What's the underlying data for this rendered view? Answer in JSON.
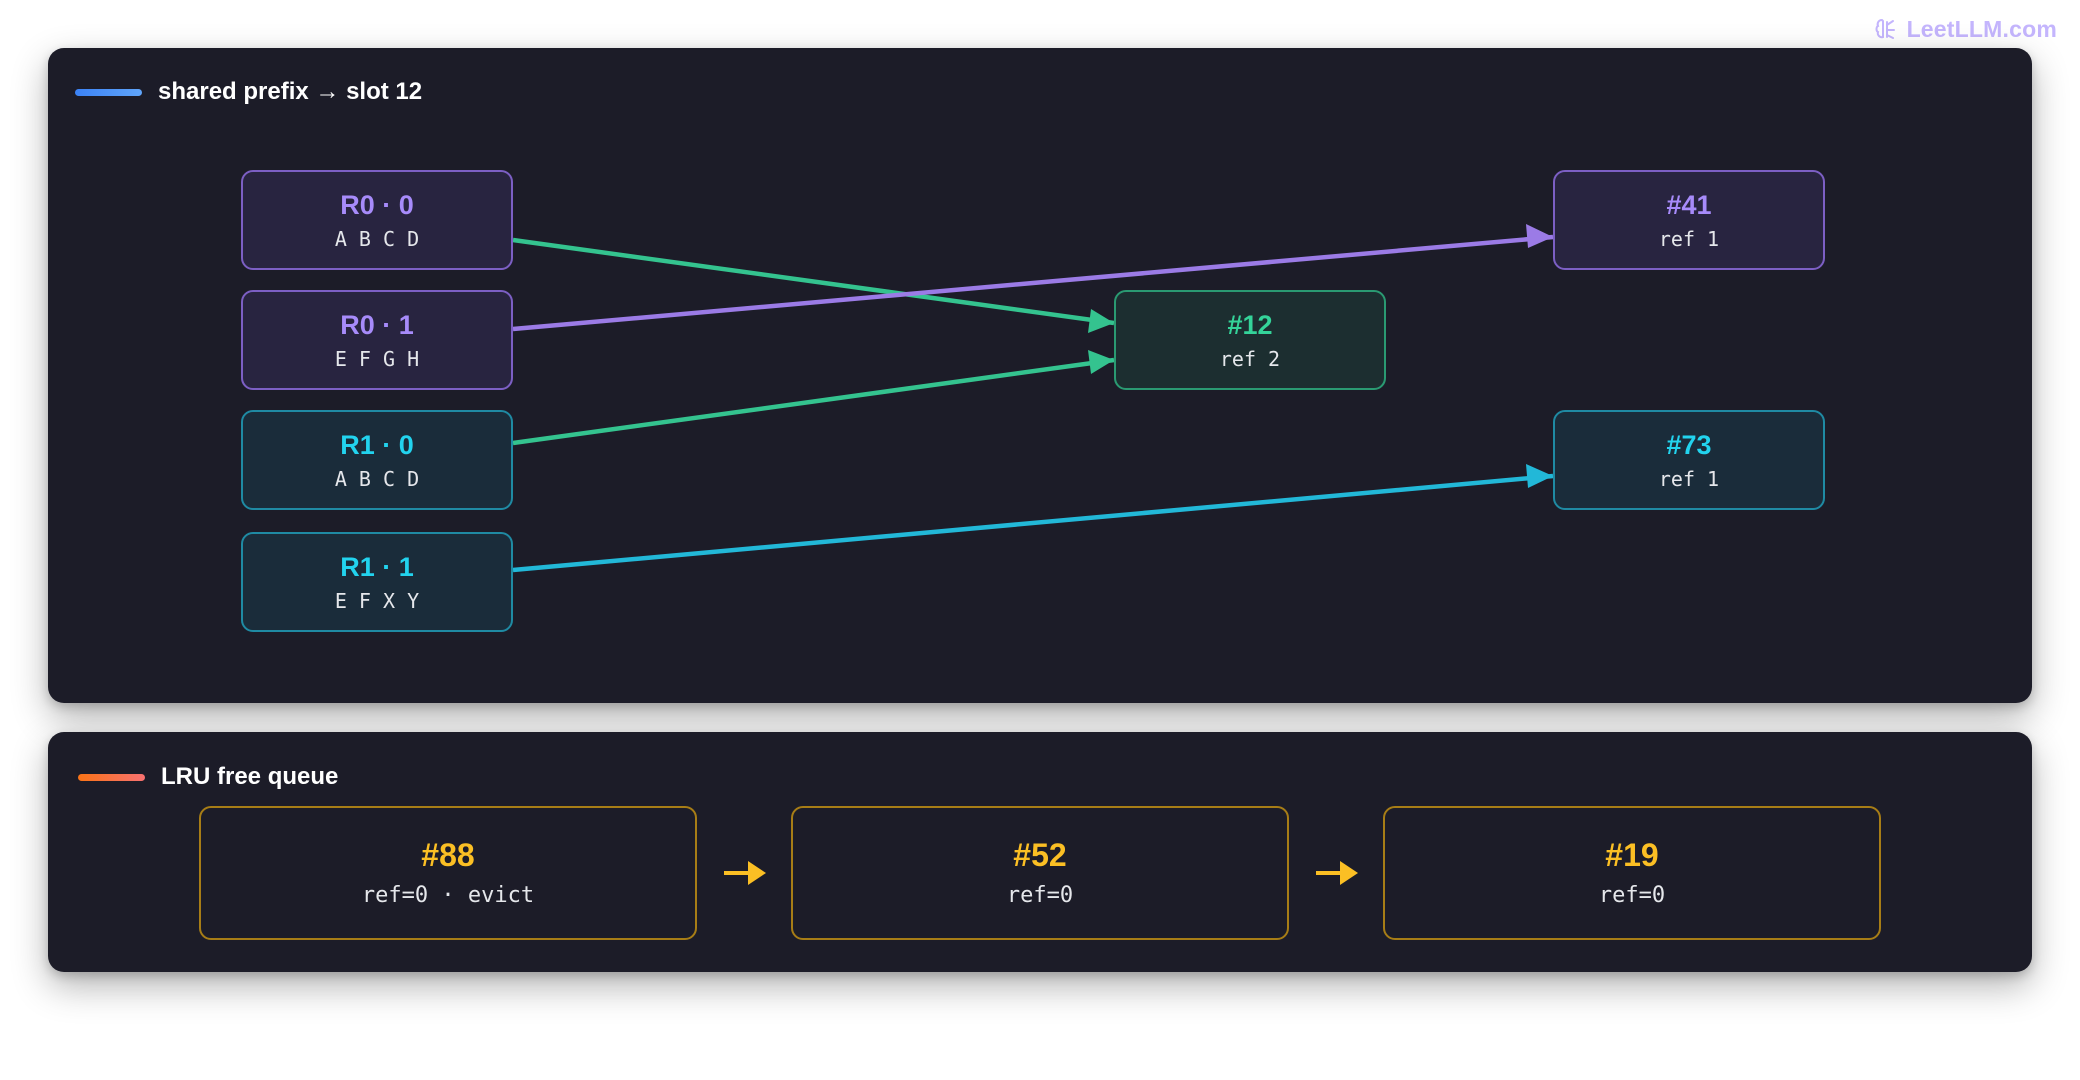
{
  "watermark": {
    "text": "LeetLLM.com"
  },
  "top_panel": {
    "legend": "shared prefix → slot 12",
    "requests": [
      {
        "title": "R0 · 0",
        "tokens": "A B C D",
        "color": "purple"
      },
      {
        "title": "R0 · 1",
        "tokens": "E F G H",
        "color": "purple"
      },
      {
        "title": "R1 · 0",
        "tokens": "A B C D",
        "color": "teal"
      },
      {
        "title": "R1 · 1",
        "tokens": "E F X Y",
        "color": "teal"
      }
    ],
    "blocks": [
      {
        "title": "#12",
        "ref": "ref 2",
        "color": "green"
      },
      {
        "title": "#41",
        "ref": "ref 1",
        "color": "purple"
      },
      {
        "title": "#73",
        "ref": "ref 1",
        "color": "teal"
      }
    ],
    "edges": [
      {
        "from": "R0 · 0",
        "to": "#12",
        "color": "#34c38f"
      },
      {
        "from": "R0 · 1",
        "to": "#41",
        "color": "#9b7be6"
      },
      {
        "from": "R1 · 0",
        "to": "#12",
        "color": "#34c38f"
      },
      {
        "from": "R1 · 1",
        "to": "#73",
        "color": "#22b8d8"
      }
    ]
  },
  "bottom_panel": {
    "legend": "LRU free queue",
    "queue": [
      {
        "title": "#88",
        "sub": "ref=0 · evict"
      },
      {
        "title": "#52",
        "sub": "ref=0"
      },
      {
        "title": "#19",
        "sub": "ref=0"
      }
    ]
  },
  "colors": {
    "panel_bg": "#1c1c28",
    "purple": "#a78bfa",
    "teal": "#22d3ee",
    "green": "#34d399",
    "amber": "#fbbf24"
  }
}
